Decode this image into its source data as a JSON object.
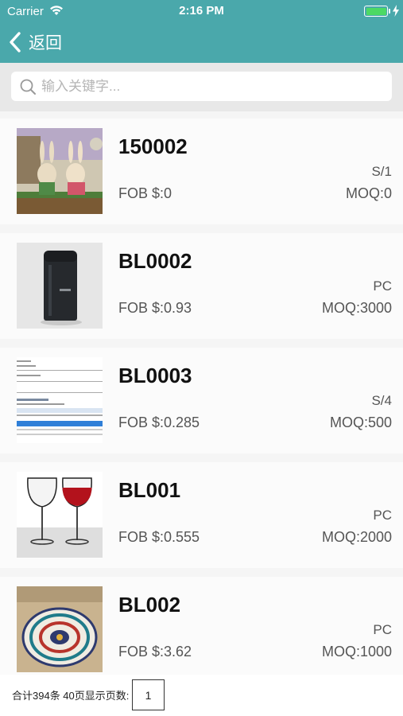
{
  "status_bar": {
    "carrier": "Carrier",
    "time": "2:16 PM"
  },
  "nav": {
    "back_label": "返回"
  },
  "search": {
    "placeholder": "输入关键字..."
  },
  "products": [
    {
      "code": "150002",
      "unit": "S/1",
      "price": "FOB $:0",
      "moq": "MOQ:0",
      "image": "rabbit-figurines-photo"
    },
    {
      "code": "BL0002",
      "unit": "PC",
      "price": "FOB $:0.93",
      "moq": "MOQ:3000",
      "image": "black-tube-photo"
    },
    {
      "code": "BL0003",
      "unit": "S/4",
      "price": "FOB $:0.285",
      "moq": "MOQ:500",
      "image": "document-screenshot"
    },
    {
      "code": "BL001",
      "unit": "PC",
      "price": "FOB $:0.555",
      "moq": "MOQ:2000",
      "image": "wine-glasses-photo"
    },
    {
      "code": "BL002",
      "unit": "PC",
      "price": "FOB $:3.62",
      "moq": "MOQ:1000",
      "image": "decorative-coaster-photo"
    }
  ],
  "footer": {
    "summary": "合计394条 40页显示页数:",
    "page_value": "1"
  },
  "colors": {
    "nav_background": "#4aa8ab",
    "battery": "#4cd964"
  }
}
